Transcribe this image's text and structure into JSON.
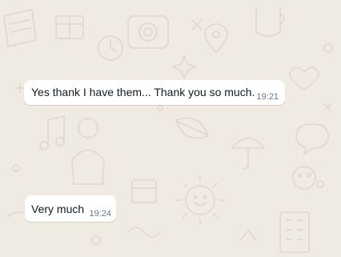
{
  "chat": {
    "messages": [
      {
        "text": "Yes thank I have them... Thank you so much.",
        "time": "19:21"
      },
      {
        "text": "Very much",
        "time": "19:24"
      }
    ]
  },
  "colors": {
    "background": "#efeae2",
    "bubble": "#ffffff",
    "text": "#111b21",
    "timestamp": "#667781",
    "doodle": "#e3ddd2"
  },
  "icons": [
    "chat-wallpaper-doodle-icons"
  ]
}
